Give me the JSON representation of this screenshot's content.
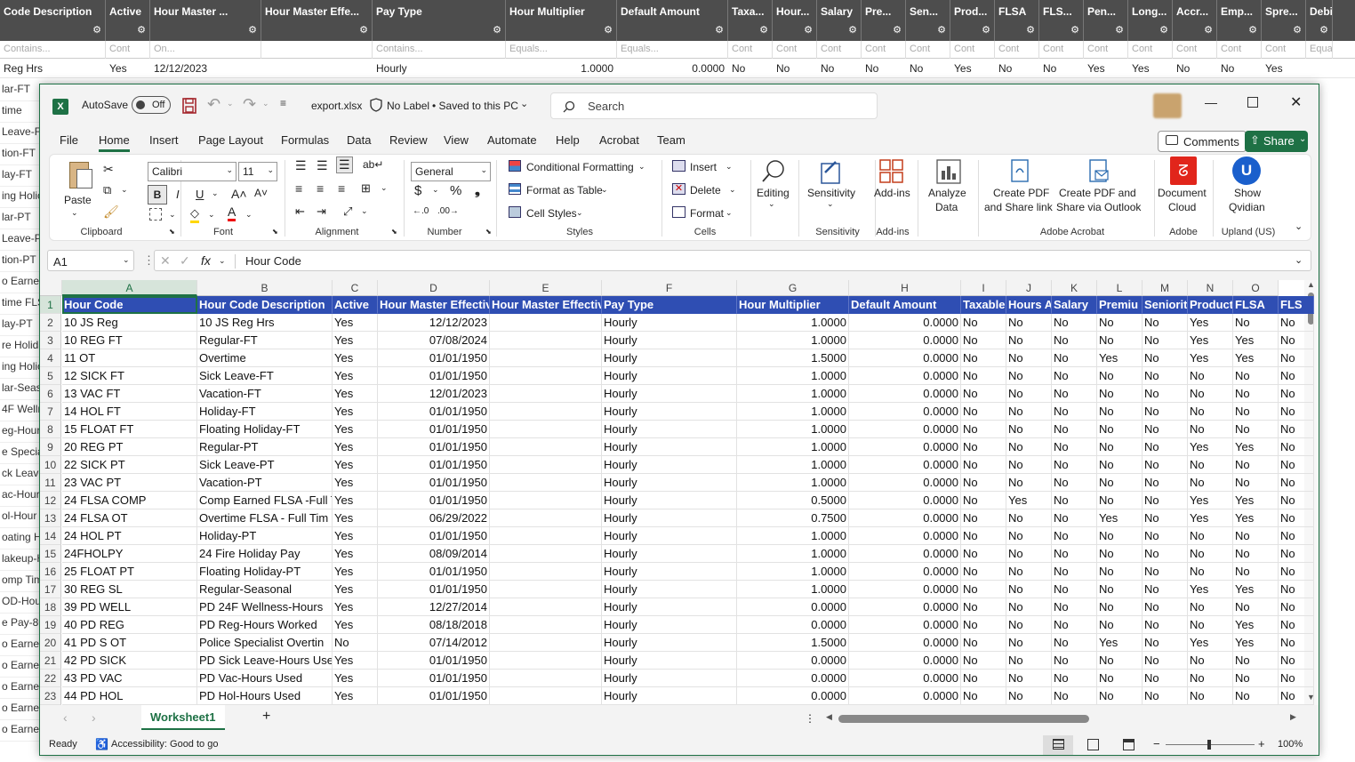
{
  "background": {
    "headers": [
      "Code Description",
      "Active",
      "Hour Master ...",
      "Hour Master Effe...",
      "Pay Type",
      "Hour Multiplier",
      "Default Amount",
      "Taxa...",
      "Hour...",
      "Salary",
      "Pre...",
      "Sen...",
      "Prod...",
      "FLSA",
      "FLS...",
      "Pen...",
      "Long...",
      "Accr...",
      "Emp...",
      "Spre...",
      "Debi..."
    ],
    "filters": [
      "Contains...",
      "Cont",
      "On...",
      "",
      "Contains...",
      "Equals...",
      "Equals...",
      "Cont",
      "Cont",
      "Cont",
      "Cont",
      "Cont",
      "Cont",
      "Cont",
      "Cont",
      "Cont",
      "Cont",
      "Cont",
      "Cont",
      "Cont",
      "Equa"
    ],
    "first_row": [
      "Reg Hrs",
      "Yes",
      "12/12/2023",
      "",
      "Hourly",
      "1.0000",
      "0.0000",
      "No",
      "No",
      "No",
      "No",
      "No",
      "Yes",
      "No",
      "No",
      "Yes",
      "Yes",
      "No",
      "No",
      "Yes",
      ""
    ],
    "side_items": [
      "lar-FT",
      "time",
      "Leave-FT",
      "tion-FT",
      "lay-FT",
      "ing Holic",
      "lar-PT",
      "Leave-PT",
      "tion-PT",
      "o Earned",
      "time FLS",
      "lay-PT",
      "re Holida",
      "ing Holic",
      "lar-Seas",
      "4F Welln",
      "eg-Hour",
      "e Special",
      "ck Leave",
      "ac-Hour",
      "ol-Hour",
      "oating H",
      "lakeup-H",
      "omp Tim",
      "OD-Hour",
      "e Pay-80",
      "o Earned",
      "o Earned",
      "o Earned",
      "o Earned",
      "o Earned"
    ]
  },
  "titlebar": {
    "autosave": "AutoSave",
    "toggle": "Off",
    "filename": "export.xlsx",
    "label": "No Label",
    "saved": "• Saved to this PC",
    "search_placeholder": "Search"
  },
  "menu": {
    "items": [
      "File",
      "Home",
      "Insert",
      "Page Layout",
      "Formulas",
      "Data",
      "Review",
      "View",
      "Automate",
      "Help",
      "Acrobat",
      "Team"
    ],
    "comments": "Comments",
    "share": "Share"
  },
  "ribbon": {
    "paste": "Paste",
    "font_name": "Calibri",
    "font_size": "11",
    "number_format": "General",
    "conditional": "Conditional Formatting",
    "format_table": "Format as Table",
    "cell_styles": "Cell Styles",
    "insert": "Insert",
    "delete": "Delete",
    "format": "Format",
    "editing": "Editing",
    "sensitivity": "Sensitivity",
    "addins": "Add-ins",
    "analyze": "Analyze",
    "analyze2": "Data",
    "pdf_share1": "Create PDF",
    "pdf_share2": "and Share link",
    "pdf_outlook1": "Create PDF and",
    "pdf_outlook2": "Share via Outlook",
    "doc_cloud1": "Document",
    "doc_cloud2": "Cloud",
    "qvidian1": "Show",
    "qvidian2": "Qvidian",
    "groups": [
      "Clipboard",
      "Font",
      "Alignment",
      "Number",
      "Styles",
      "Cells",
      "Sensitivity",
      "Add-ins",
      "Adobe Acrobat",
      "Adobe",
      "Upland (US)"
    ]
  },
  "formula": {
    "namebox": "A1",
    "fx": "fx",
    "value": "Hour Code"
  },
  "sheet": {
    "columns": [
      "A",
      "B",
      "C",
      "D",
      "E",
      "F",
      "G",
      "H",
      "I",
      "J",
      "K",
      "L",
      "M",
      "N",
      "O"
    ],
    "header_row": [
      "Hour Code",
      "Hour Code Description",
      "Active",
      "Hour Master Effectiv",
      "Hour Master Effectiv",
      "Pay Type",
      "Hour Multiplier",
      "Default Amount",
      "Taxable",
      "Hours A",
      "Salary",
      "Premiu",
      "Seniorit",
      "Product",
      "FLSA",
      "FLS"
    ],
    "rows": [
      [
        "10 JS Reg",
        "10 JS Reg Hrs",
        "Yes",
        "12/12/2023",
        "",
        "Hourly",
        "1.0000",
        "0.0000",
        "No",
        "No",
        "No",
        "No",
        "No",
        "Yes",
        "No",
        "No"
      ],
      [
        "10 REG FT",
        "Regular-FT",
        "Yes",
        "07/08/2024",
        "",
        "Hourly",
        "1.0000",
        "0.0000",
        "No",
        "No",
        "No",
        "No",
        "No",
        "Yes",
        "Yes",
        "No"
      ],
      [
        "11 OT",
        "Overtime",
        "Yes",
        "01/01/1950",
        "",
        "Hourly",
        "1.5000",
        "0.0000",
        "No",
        "No",
        "No",
        "Yes",
        "No",
        "Yes",
        "Yes",
        "No"
      ],
      [
        "12 SICK FT",
        "Sick Leave-FT",
        "Yes",
        "01/01/1950",
        "",
        "Hourly",
        "1.0000",
        "0.0000",
        "No",
        "No",
        "No",
        "No",
        "No",
        "No",
        "No",
        "No"
      ],
      [
        "13 VAC FT",
        "Vacation-FT",
        "Yes",
        "12/01/2023",
        "",
        "Hourly",
        "1.0000",
        "0.0000",
        "No",
        "No",
        "No",
        "No",
        "No",
        "No",
        "No",
        "No"
      ],
      [
        "14 HOL FT",
        "Holiday-FT",
        "Yes",
        "01/01/1950",
        "",
        "Hourly",
        "1.0000",
        "0.0000",
        "No",
        "No",
        "No",
        "No",
        "No",
        "No",
        "No",
        "No"
      ],
      [
        "15 FLOAT FT",
        "Floating Holiday-FT",
        "Yes",
        "01/01/1950",
        "",
        "Hourly",
        "1.0000",
        "0.0000",
        "No",
        "No",
        "No",
        "No",
        "No",
        "No",
        "No",
        "No"
      ],
      [
        "20 REG PT",
        "Regular-PT",
        "Yes",
        "01/01/1950",
        "",
        "Hourly",
        "1.0000",
        "0.0000",
        "No",
        "No",
        "No",
        "No",
        "No",
        "Yes",
        "Yes",
        "No"
      ],
      [
        "22 SICK PT",
        "Sick Leave-PT",
        "Yes",
        "01/01/1950",
        "",
        "Hourly",
        "1.0000",
        "0.0000",
        "No",
        "No",
        "No",
        "No",
        "No",
        "No",
        "No",
        "No"
      ],
      [
        "23 VAC PT",
        "Vacation-PT",
        "Yes",
        "01/01/1950",
        "",
        "Hourly",
        "1.0000",
        "0.0000",
        "No",
        "No",
        "No",
        "No",
        "No",
        "No",
        "No",
        "No"
      ],
      [
        "24 FLSA COMP",
        "Comp Earned FLSA -Full T",
        "Yes",
        "01/01/1950",
        "",
        "Hourly",
        "0.5000",
        "0.0000",
        "No",
        "Yes",
        "No",
        "No",
        "No",
        "Yes",
        "Yes",
        "No"
      ],
      [
        "24 FLSA OT",
        "Overtime FLSA - Full Tim",
        "Yes",
        "06/29/2022",
        "",
        "Hourly",
        "0.7500",
        "0.0000",
        "No",
        "No",
        "No",
        "Yes",
        "No",
        "Yes",
        "Yes",
        "No"
      ],
      [
        "24 HOL PT",
        "Holiday-PT",
        "Yes",
        "01/01/1950",
        "",
        "Hourly",
        "1.0000",
        "0.0000",
        "No",
        "No",
        "No",
        "No",
        "No",
        "No",
        "No",
        "No"
      ],
      [
        "24FHOLPY",
        "24 Fire Holiday Pay",
        "Yes",
        "08/09/2014",
        "",
        "Hourly",
        "1.0000",
        "0.0000",
        "No",
        "No",
        "No",
        "No",
        "No",
        "No",
        "No",
        "No"
      ],
      [
        "25 FLOAT PT",
        "Floating Holiday-PT",
        "Yes",
        "01/01/1950",
        "",
        "Hourly",
        "1.0000",
        "0.0000",
        "No",
        "No",
        "No",
        "No",
        "No",
        "No",
        "No",
        "No"
      ],
      [
        "30 REG SL",
        "Regular-Seasonal",
        "Yes",
        "01/01/1950",
        "",
        "Hourly",
        "1.0000",
        "0.0000",
        "No",
        "No",
        "No",
        "No",
        "No",
        "Yes",
        "Yes",
        "No"
      ],
      [
        "39 PD WELL",
        "PD 24F  Wellness-Hours",
        "Yes",
        "12/27/2014",
        "",
        "Hourly",
        "0.0000",
        "0.0000",
        "No",
        "No",
        "No",
        "No",
        "No",
        "No",
        "No",
        "No"
      ],
      [
        "40 PD REG",
        "PD Reg-Hours Worked",
        "Yes",
        "08/18/2018",
        "",
        "Hourly",
        "0.0000",
        "0.0000",
        "No",
        "No",
        "No",
        "No",
        "No",
        "No",
        "Yes",
        "No"
      ],
      [
        "41 PD S OT",
        "Police Specialist Overtin",
        "No",
        "07/14/2012",
        "",
        "Hourly",
        "1.5000",
        "0.0000",
        "No",
        "No",
        "No",
        "Yes",
        "No",
        "Yes",
        "Yes",
        "No"
      ],
      [
        "42 PD SICK",
        "PD Sick Leave-Hours Use",
        "Yes",
        "01/01/1950",
        "",
        "Hourly",
        "0.0000",
        "0.0000",
        "No",
        "No",
        "No",
        "No",
        "No",
        "No",
        "No",
        "No"
      ],
      [
        "43 PD VAC",
        "PD Vac-Hours Used",
        "Yes",
        "01/01/1950",
        "",
        "Hourly",
        "0.0000",
        "0.0000",
        "No",
        "No",
        "No",
        "No",
        "No",
        "No",
        "No",
        "No"
      ],
      [
        "44 PD HOL",
        "PD Hol-Hours Used",
        "Yes",
        "01/01/1950",
        "",
        "Hourly",
        "0.0000",
        "0.0000",
        "No",
        "No",
        "No",
        "No",
        "No",
        "No",
        "No",
        "No"
      ]
    ]
  },
  "sheetbar": {
    "tab": "Worksheet1",
    "add": "+"
  },
  "status": {
    "ready": "Ready",
    "accessibility": "Accessibility: Good to go",
    "zoom": "100%"
  }
}
